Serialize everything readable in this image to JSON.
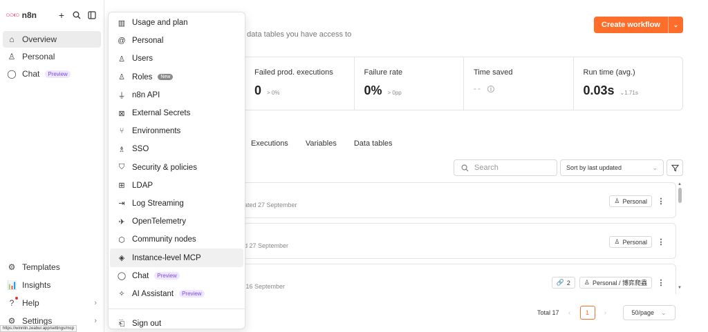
{
  "sidebar": {
    "brand": "n8n",
    "nav": [
      {
        "label": "Overview",
        "icon": "home-icon"
      },
      {
        "label": "Personal",
        "icon": "user-icon"
      },
      {
        "label": "Chat",
        "icon": "chat-icon",
        "badge": "Preview"
      }
    ],
    "bottom": [
      {
        "label": "Templates",
        "icon": "templates-icon"
      },
      {
        "label": "Insights",
        "icon": "insights-icon"
      },
      {
        "label": "Help",
        "icon": "help-icon"
      },
      {
        "label": "Settings",
        "icon": "settings-icon"
      }
    ],
    "status_url": "https://winnlin.zeabur.app/settings/mcp"
  },
  "menu": {
    "items": [
      {
        "label": "Usage and plan",
        "icon": "chart-icon"
      },
      {
        "label": "Personal",
        "icon": "at-icon"
      },
      {
        "label": "Users",
        "icon": "user-icon"
      },
      {
        "label": "Roles",
        "icon": "user-icon",
        "badge": "New"
      },
      {
        "label": "n8n API",
        "icon": "plug-icon"
      },
      {
        "label": "External Secrets",
        "icon": "vault-icon"
      },
      {
        "label": "Environments",
        "icon": "branch-icon"
      },
      {
        "label": "SSO",
        "icon": "sso-icon"
      },
      {
        "label": "Security & policies",
        "icon": "shield-icon"
      },
      {
        "label": "LDAP",
        "icon": "network-icon"
      },
      {
        "label": "Log Streaming",
        "icon": "log-icon"
      },
      {
        "label": "OpenTelemetry",
        "icon": "telescope-icon"
      },
      {
        "label": "Community nodes",
        "icon": "cube-icon"
      },
      {
        "label": "Instance-level MCP",
        "icon": "mcp-icon"
      },
      {
        "label": "Chat",
        "icon": "chat-icon",
        "badge": "Preview"
      },
      {
        "label": "AI Assistant",
        "icon": "sparkle-icon",
        "badge": "Preview"
      }
    ],
    "sign_out": "Sign out"
  },
  "header": {
    "subtitle": "d data tables you have access to",
    "create_label": "Create workflow"
  },
  "stats": [
    {
      "label": "Failed prod. executions",
      "value": "0",
      "delta": "> 0%"
    },
    {
      "label": "Failure rate",
      "value": "0%",
      "delta": "> 0pp"
    },
    {
      "label": "Time saved",
      "value": "--"
    },
    {
      "label": "Run time (avg.)",
      "value": "0.03s",
      "delta": "⌄1.71s"
    }
  ],
  "tabs": [
    "Executions",
    "Variables",
    "Data tables"
  ],
  "controls": {
    "search_placeholder": "Search",
    "sort_label": "Sort by last updated"
  },
  "rows": [
    {
      "meta": "eated 27 September",
      "owner": "Personal"
    },
    {
      "meta": "ed 27 September",
      "owner": "Personal"
    },
    {
      "meta": "d 16 September",
      "owner": "Personal / 博弈爬蟲",
      "shared": "2"
    }
  ],
  "pagination": {
    "total": "Total 17",
    "current": "1",
    "per_page": "50/page"
  },
  "colors": {
    "accent": "#ff6d2b",
    "brand": "#ea4b71",
    "badge": "#7b4ce0"
  }
}
